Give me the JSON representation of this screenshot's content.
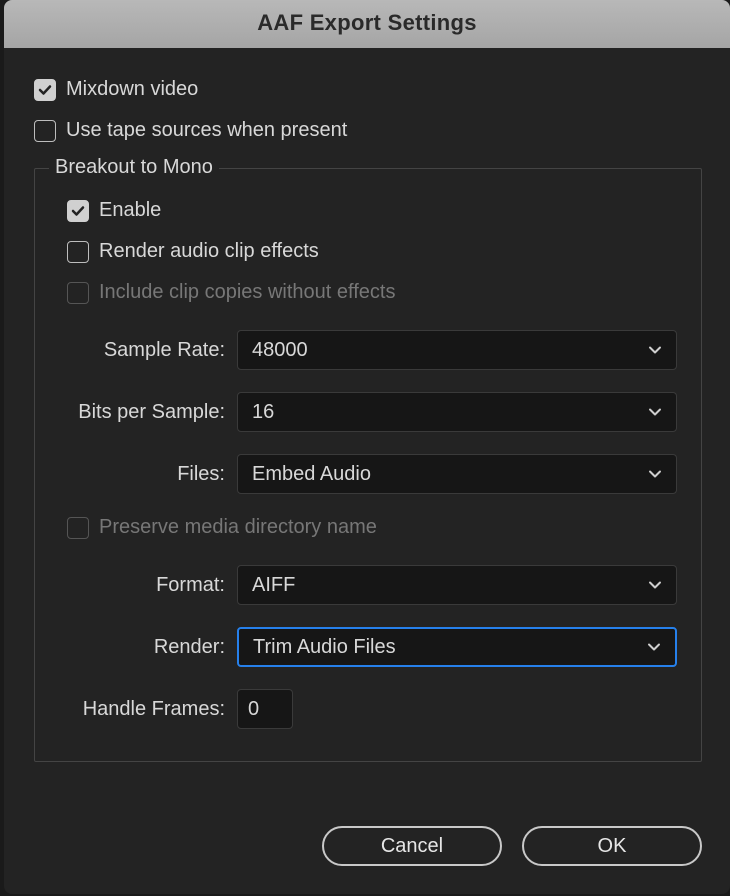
{
  "title": "AAF Export Settings",
  "checkboxes": {
    "mixdown_video": {
      "label": "Mixdown video",
      "checked": true
    },
    "use_tape_sources": {
      "label": "Use tape sources when present",
      "checked": false
    }
  },
  "breakout": {
    "legend": "Breakout to Mono",
    "enable": {
      "label": "Enable",
      "checked": true
    },
    "render_effects": {
      "label": "Render audio clip effects",
      "checked": false
    },
    "include_copies": {
      "label": "Include clip copies without effects",
      "checked": false,
      "disabled": true
    },
    "sample_rate": {
      "label": "Sample Rate:",
      "value": "48000"
    },
    "bits_per_sample": {
      "label": "Bits per Sample:",
      "value": "16"
    },
    "files": {
      "label": "Files:",
      "value": "Embed Audio"
    },
    "preserve_dir": {
      "label": "Preserve media directory name",
      "checked": false,
      "disabled": true
    },
    "format": {
      "label": "Format:",
      "value": "AIFF"
    },
    "render": {
      "label": "Render:",
      "value": "Trim Audio Files"
    },
    "handle_frames": {
      "label": "Handle Frames:",
      "value": "0"
    }
  },
  "buttons": {
    "cancel": "Cancel",
    "ok": "OK"
  }
}
